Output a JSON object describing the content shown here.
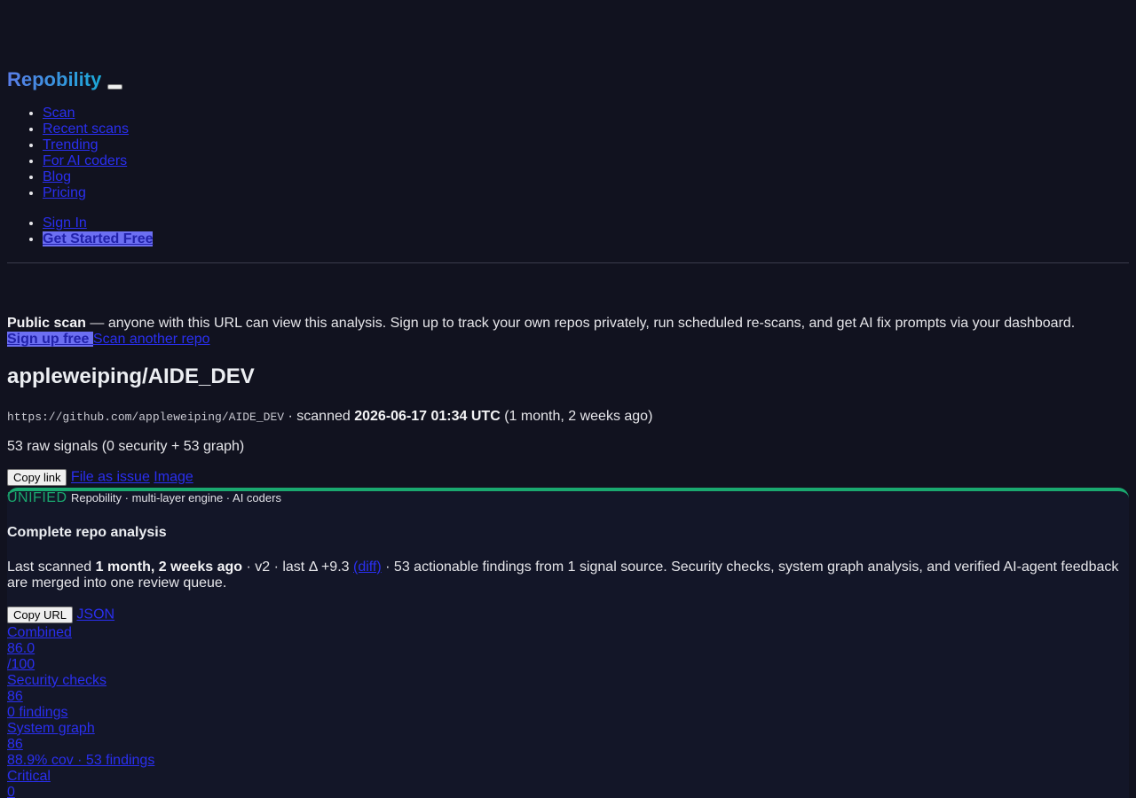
{
  "header": {
    "brand": "Repobility",
    "nav": [
      "Scan",
      "Recent scans",
      "Trending",
      "For AI coders",
      "Blog",
      "Pricing"
    ],
    "auth": {
      "sign_in": "Sign In",
      "get_started": "Get Started Free"
    }
  },
  "notice": {
    "strong": "Public scan",
    "text": " — anyone with this URL can view this analysis. Sign up to track your own repos privately, run scheduled re-scans, and get AI fix prompts via your dashboard.",
    "signup": "Sign up free ",
    "scan_another": "Scan another repo"
  },
  "repo": {
    "title": "appleweiping/AIDE_DEV",
    "url": "https://github.com/appleweiping/AIDE_DEV",
    "scanned_prefix": " · scanned ",
    "scanned_at": "2026-06-17 01:34 UTC",
    "scanned_ago": " (1 month, 2 weeks ago)",
    "signals": "53 raw signals (0 security + 53 graph)"
  },
  "actions": {
    "copy_link": "Copy link",
    "file_issue": "File as issue",
    "image": "Image",
    "copy_url": "Copy URL",
    "json": "JSON"
  },
  "panel": {
    "badge": "UNIFIED",
    "engine": "Repobility · multi-layer engine · AI coders",
    "title": "Complete repo analysis",
    "summary_prefix": "Last scanned ",
    "summary_time": "1 month, 2 weeks ago",
    "summary_mid": " · v2 · last Δ +9.3 ",
    "diff": "(diff)",
    "summary_rest": " · 53 actionable findings from 1 signal source. Security checks, system graph analysis, and verified AI-agent feedback are merged into one review queue."
  },
  "stats": [
    "Combined",
    "86.0",
    "/100",
    "Security checks",
    "86",
    "0 findings",
    "System graph",
    "86",
    "88.9% cov · 53 findings",
    "Critical",
    "0"
  ],
  "colors": {
    "background": "#11121f",
    "accent_green": "#1aa86f",
    "brand_gradient_start": "#5a7de8",
    "brand_gradient_end": "#1ba8d6",
    "cta": "#6c6ff2"
  }
}
